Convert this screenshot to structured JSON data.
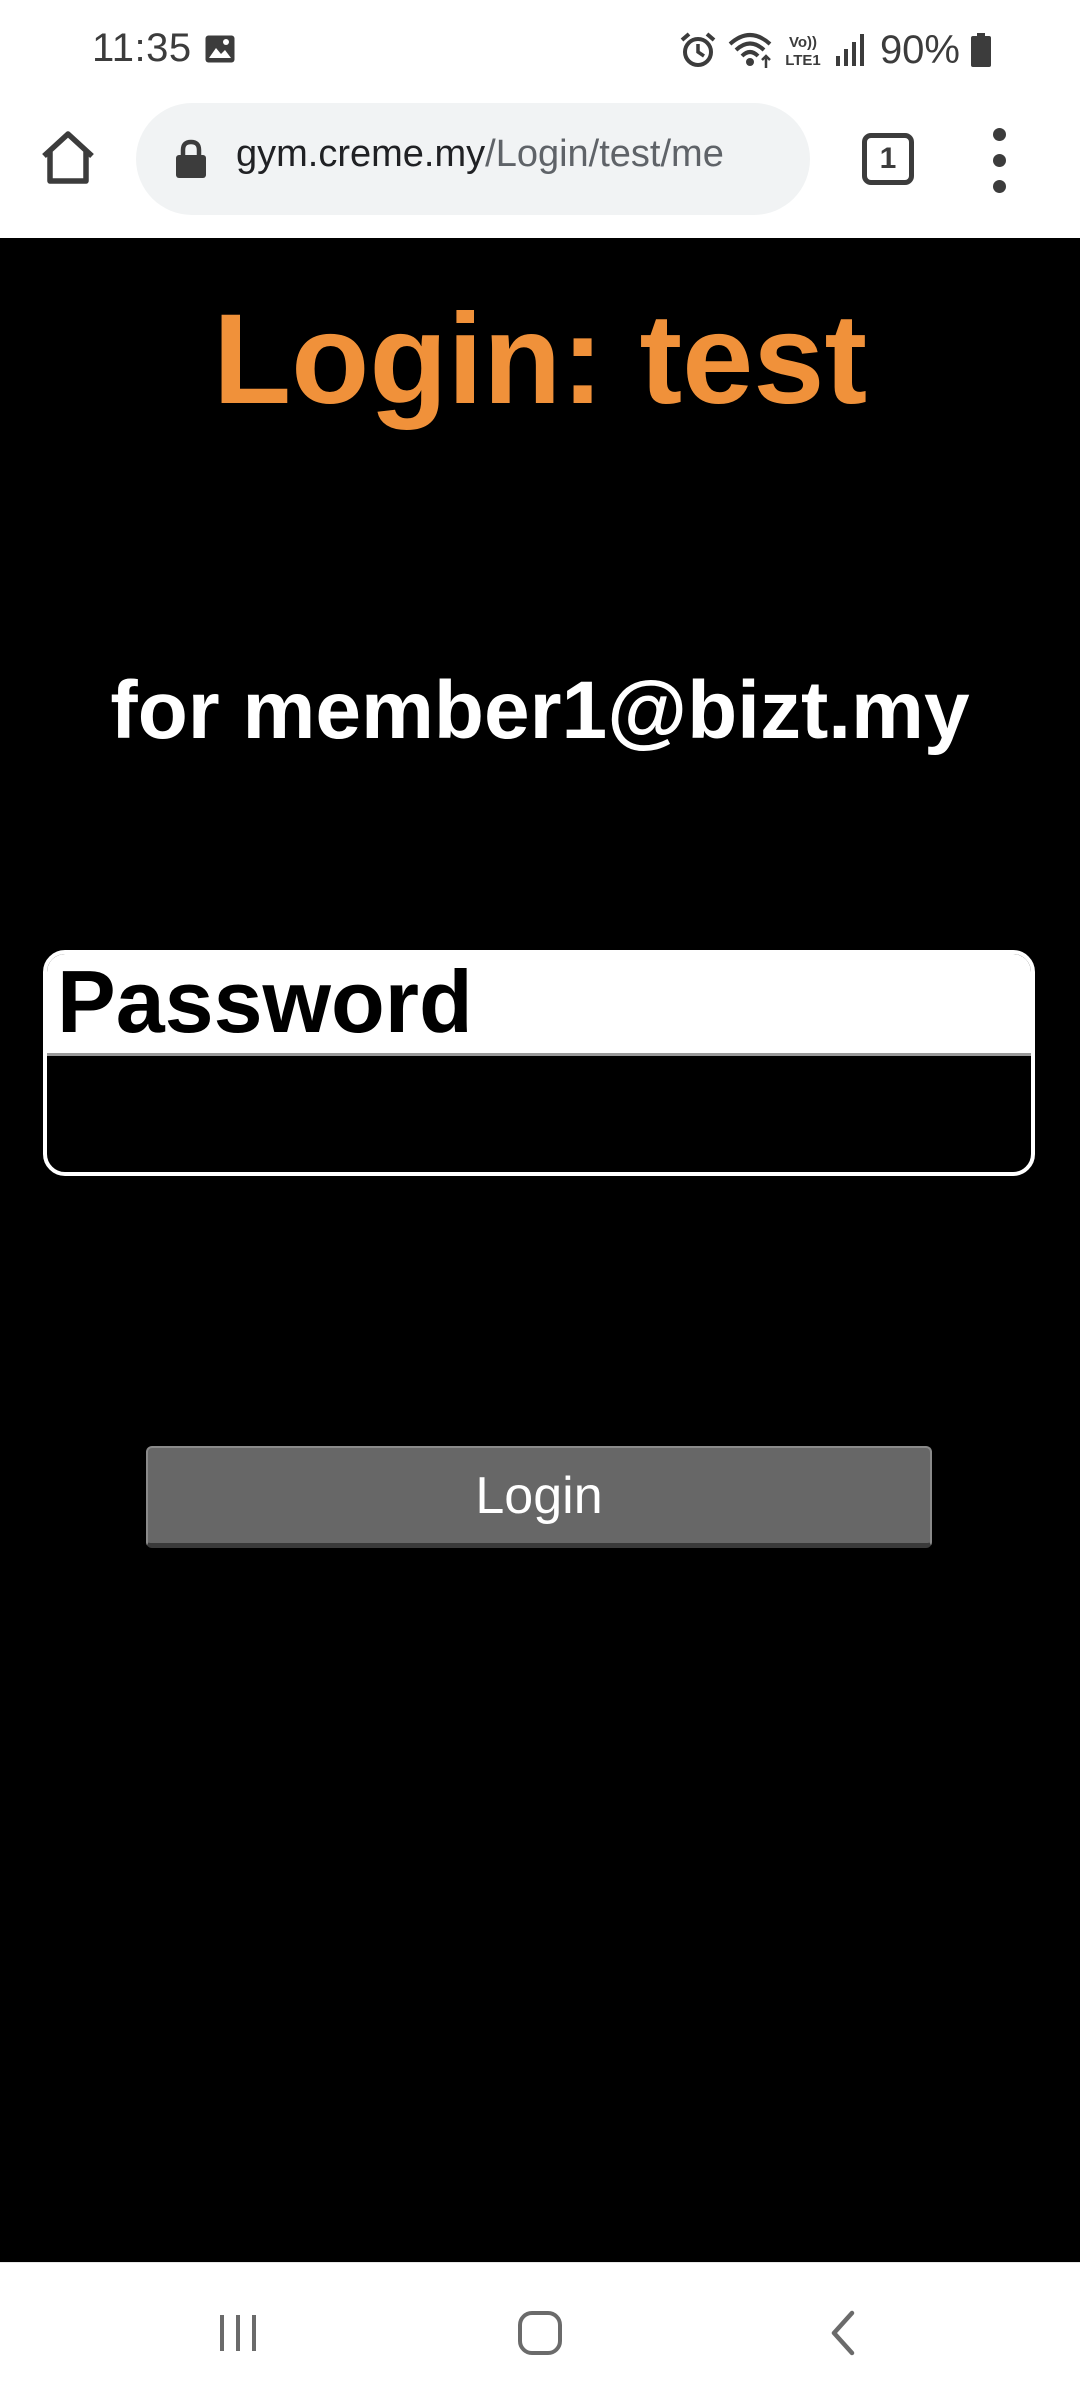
{
  "status_bar": {
    "time": "11:35",
    "battery_percent": "90%",
    "icons": [
      "gallery-icon",
      "alarm-icon",
      "wifi-icon",
      "volte-icon",
      "signal-icon",
      "battery-icon"
    ],
    "volte_line1": "Vo))",
    "volte_line2": "LTE1"
  },
  "browser": {
    "url_domain": "gym.creme.my",
    "url_path": "/Login/test/me",
    "tab_count": "1",
    "icons": [
      "home-icon",
      "lock-icon",
      "tabs-icon",
      "more-vert-icon"
    ]
  },
  "page": {
    "title": "Login: test",
    "subtitle": "for member1@bizt.my",
    "password_label": "Password",
    "password_value": "",
    "login_button": "Login",
    "title_color": "#f0913a",
    "background_color": "#000000",
    "button_color": "#676767"
  },
  "nav_bar": {
    "icons": [
      "recent-apps-icon",
      "home-nav-icon",
      "back-icon"
    ]
  }
}
